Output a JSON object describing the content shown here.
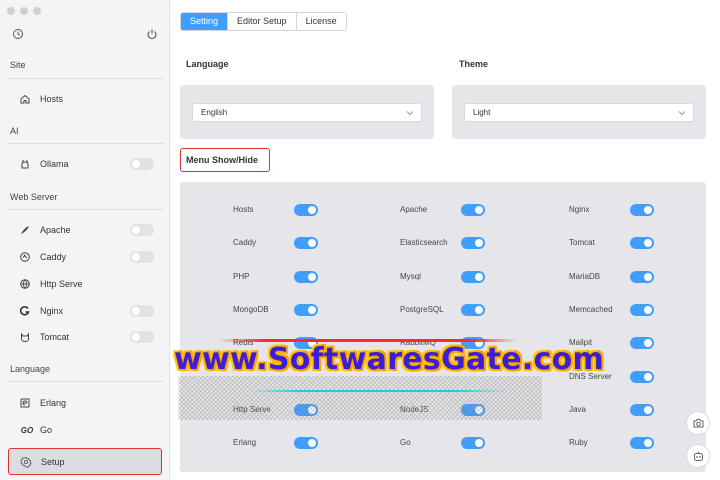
{
  "sidebar": {
    "sections": {
      "site": "Site",
      "ai": "AI",
      "web_server": "Web Server",
      "language": "Language"
    },
    "items": {
      "hosts": "Hosts",
      "ollama": "Ollama",
      "apache": "Apache",
      "caddy": "Caddy",
      "http_serve": "Http Serve",
      "nginx": "Nginx",
      "tomcat": "Tomcat",
      "erlang": "Erlang",
      "go": "Go",
      "setup": "Setup"
    },
    "icons": {
      "go_glyph": "GO"
    }
  },
  "tabs": [
    "Setting",
    "Editor Setup",
    "License"
  ],
  "language_label": "Language",
  "language_value": "English",
  "theme_label": "Theme",
  "theme_value": "Light",
  "menu_show_hide": "Menu Show/Hide",
  "menu_items": [
    [
      "Hosts",
      "Apache",
      "Nginx"
    ],
    [
      "Caddy",
      "Elasticsearch",
      "Tomcat"
    ],
    [
      "PHP",
      "Mysql",
      "MariaDB"
    ],
    [
      "MongoDB",
      "PostgreSQL",
      "Memcached"
    ],
    [
      "Redis",
      "RabbitMQ",
      "Mailpit"
    ],
    [
      "",
      "",
      "DNS Server"
    ],
    [
      "Http Serve",
      "NodeJS",
      "Java"
    ],
    [
      "Erlang",
      "Go",
      "Ruby"
    ]
  ],
  "watermark": "www.SoftwaresGate.com",
  "colors": {
    "accent": "#409eff",
    "highlight": "#d9342b"
  }
}
